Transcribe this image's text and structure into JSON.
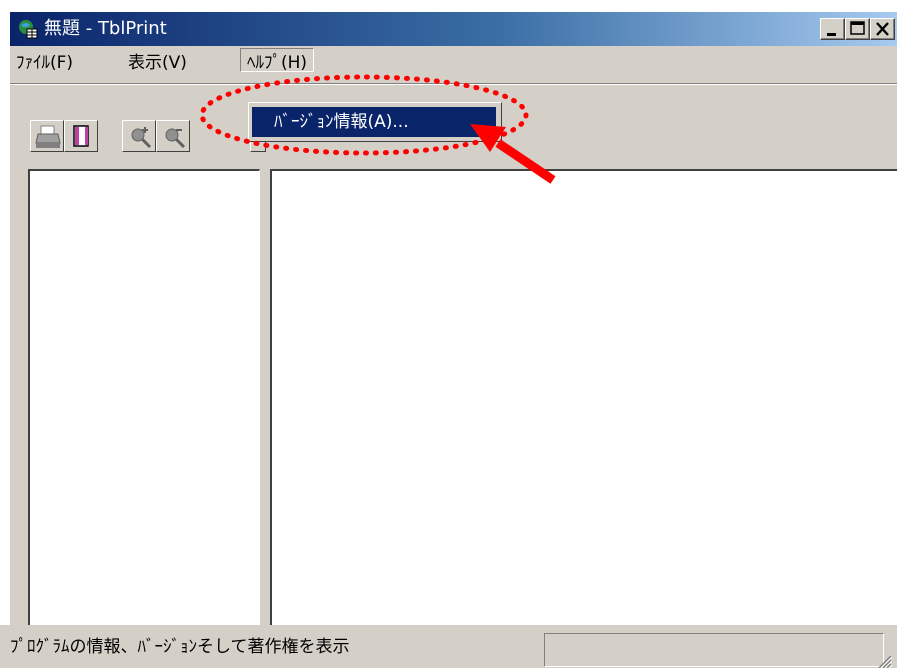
{
  "window": {
    "title": "無題 - TblPrint",
    "title_icon": "app-globe-icon"
  },
  "title_buttons": {
    "minimize_icon": "minimize-icon",
    "maximize_icon": "maximize-icon",
    "close_icon": "close-icon"
  },
  "menu": {
    "file": "ﾌｧｲﾙ(F)",
    "view": "表示(V)",
    "help": "ﾍﾙﾌﾟ(H)"
  },
  "dropdown": {
    "items": [
      {
        "label": "ﾊﾞｰｼﾞｮﾝ情報(A)...",
        "selected": true
      }
    ]
  },
  "toolbar": {
    "buttons": [
      "printer-icon",
      "page-icon",
      "zoom-in-icon",
      "zoom-out-icon"
    ]
  },
  "statusbar": {
    "text": "ﾌﾟﾛｸﾞﾗﾑの情報、ﾊﾞｰｼﾞｮﾝそして著作権を表示"
  },
  "colors": {
    "titlebar_start": "#0a246a",
    "titlebar_end": "#a6caf0",
    "highlight": "#0a246a",
    "annotation_red": "#ff0000",
    "face": "#d4d0c8"
  }
}
